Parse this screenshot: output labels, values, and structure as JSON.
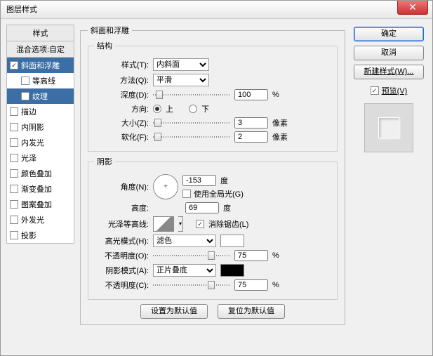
{
  "window": {
    "title": "图层样式"
  },
  "close_icon": "✕",
  "left": {
    "header": "样式",
    "subheader": "混合选项:自定",
    "items": [
      {
        "label": "斜面和浮雕",
        "checked": true,
        "selected": true,
        "indent": false
      },
      {
        "label": "等高线",
        "checked": false,
        "selected": false,
        "indent": true
      },
      {
        "label": "纹理",
        "checked": false,
        "selected": true,
        "indent": true
      },
      {
        "label": "描边",
        "checked": false,
        "selected": false,
        "indent": false
      },
      {
        "label": "内阴影",
        "checked": false,
        "selected": false,
        "indent": false
      },
      {
        "label": "内发光",
        "checked": false,
        "selected": false,
        "indent": false
      },
      {
        "label": "光泽",
        "checked": false,
        "selected": false,
        "indent": false
      },
      {
        "label": "颜色叠加",
        "checked": false,
        "selected": false,
        "indent": false
      },
      {
        "label": "渐变叠加",
        "checked": false,
        "selected": false,
        "indent": false
      },
      {
        "label": "图案叠加",
        "checked": false,
        "selected": false,
        "indent": false
      },
      {
        "label": "外发光",
        "checked": false,
        "selected": false,
        "indent": false
      },
      {
        "label": "投影",
        "checked": false,
        "selected": false,
        "indent": false
      }
    ]
  },
  "bevel": {
    "group_title": "斜面和浮雕",
    "structure_title": "结构",
    "style_label": "样式(T):",
    "style_value": "内斜面",
    "technique_label": "方法(Q):",
    "technique_value": "平滑",
    "depth_label": "深度(D):",
    "depth_value": "100",
    "percent": "%",
    "direction_label": "方向:",
    "direction_up": "上",
    "direction_down": "下",
    "size_label": "大小(Z):",
    "size_value": "3",
    "px": "像素",
    "soften_label": "软化(F):",
    "soften_value": "2",
    "shading_title": "阴影",
    "angle_label": "角度(N):",
    "angle_value": "-153",
    "deg": "度",
    "global_light_label": "使用全局光(G)",
    "global_light_checked": false,
    "altitude_label": "高度:",
    "altitude_value": "69",
    "gloss_contour_label": "光泽等高线:",
    "anti_alias_label": "消除锯齿(L)",
    "anti_alias_checked": true,
    "highlight_mode_label": "高光模式(H):",
    "highlight_mode_value": "滤色",
    "highlight_opacity_label": "不透明度(O):",
    "highlight_opacity_value": "75",
    "shadow_mode_label": "阴影模式(A):",
    "shadow_mode_value": "正片叠底",
    "shadow_opacity_label": "不透明度(C):",
    "shadow_opacity_value": "75",
    "set_default": "设置为默认值",
    "reset_default": "复位为默认值"
  },
  "right": {
    "ok": "确定",
    "cancel": "取消",
    "new_style": "新建样式(W)...",
    "preview_label": "预览(V)",
    "preview_checked": true
  }
}
